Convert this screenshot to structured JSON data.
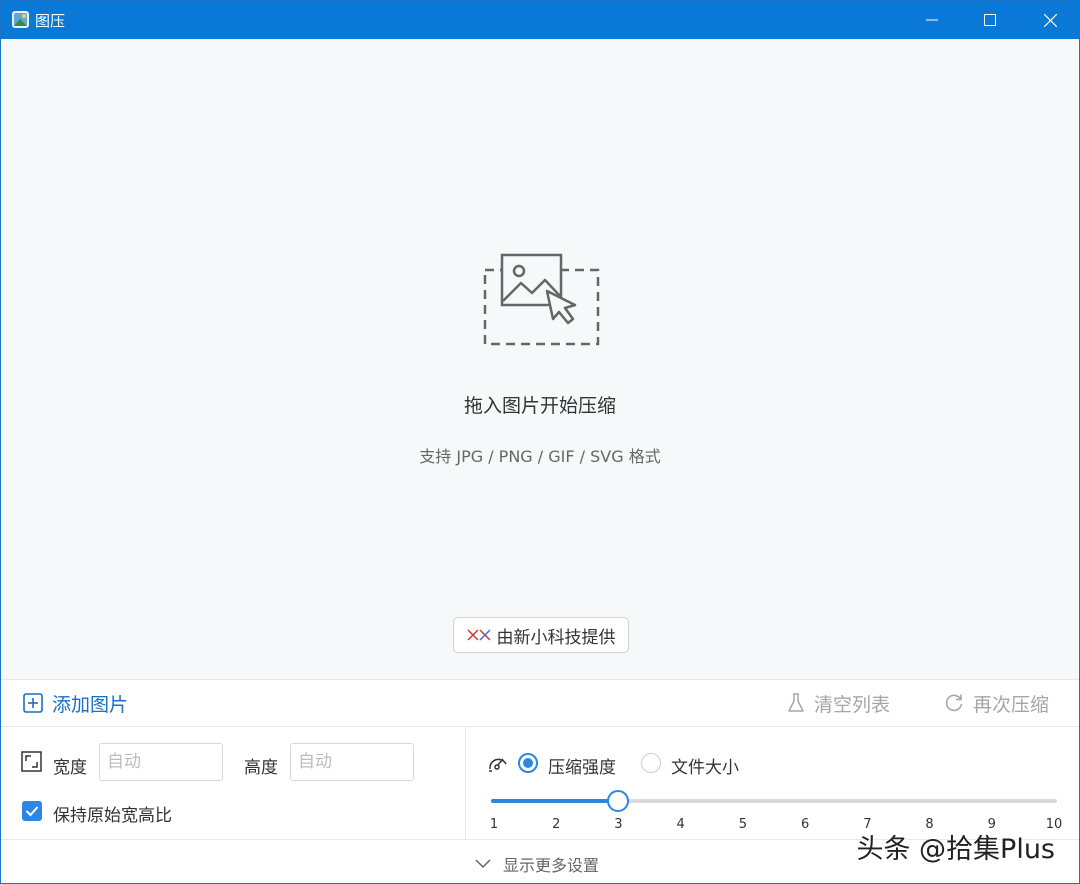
{
  "window": {
    "title": "图压",
    "app_icon": "image-app-icon",
    "controls": {
      "minimize": "minimize-icon",
      "maximize": "maximize-icon",
      "close": "close-icon"
    },
    "accent_color": "#0a78d7"
  },
  "dropzone": {
    "icon": "image-drop-icon",
    "title": "拖入图片开始压缩",
    "subtitle": "支持 JPG / PNG / GIF / SVG 格式",
    "provider_label": "由新小科技提供"
  },
  "toolbar": {
    "add_label": "添加图片",
    "clear_label": "清空列表",
    "recompress_label": "再次压缩"
  },
  "size_settings": {
    "width_label": "宽度",
    "width_placeholder": "自动",
    "height_label": "高度",
    "height_placeholder": "自动",
    "keep_ratio_label": "保持原始宽高比",
    "keep_ratio_checked": true
  },
  "compression": {
    "modes": [
      {
        "label": "压缩强度",
        "selected": true
      },
      {
        "label": "文件大小",
        "selected": false
      }
    ],
    "slider_value": 3,
    "slider_min": 1,
    "slider_max": 10,
    "ticks": [
      "1",
      "2",
      "3",
      "4",
      "5",
      "6",
      "7",
      "8",
      "9",
      "10"
    ]
  },
  "footer": {
    "more_settings_label": "显示更多设置"
  },
  "watermark": "头条 @拾集Plus"
}
